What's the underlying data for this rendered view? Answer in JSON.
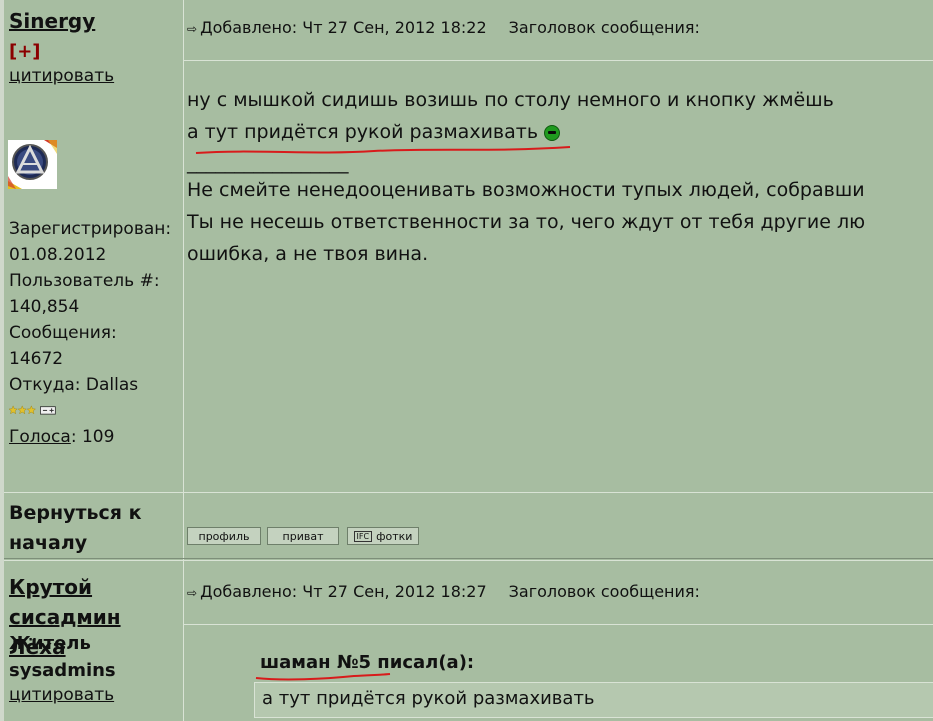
{
  "post1": {
    "author": "Sinergy",
    "plus": "[+]",
    "quote_label": "цитировать",
    "registered_label": "Зарегистрирован:",
    "registered_date": "01.08.2012",
    "user_num_label": "Пользователь #:",
    "user_num": "140,854",
    "messages_label": "Сообщения:",
    "messages": "14672",
    "from_label": "Откуда:",
    "from_value": "Dallas",
    "votes_label": "Голоса",
    "votes_value": ": 109",
    "meta_added": "Добавлено: Чт 27 Сен, 2012 18:22",
    "meta_title": "Заголовок сообщения:",
    "body_line1": "ну с мышкой сидишь возишь по столу немного и кнопку жмёшь",
    "body_line2": "а тут придётся рукой размахивать",
    "signature_rule": "_________________",
    "sig_line1": "Не смейте ненедооценивать возможности тупых людей, собравши",
    "sig_line2": "Ты не несешь ответственности за то, чего ждут от тебя другие лю",
    "sig_line3": "ошибка, а не твоя вина.",
    "back_to_top": "Вернуться к началу",
    "btn_profile": "профиль",
    "btn_private": "приват",
    "btn_photos": "фотки",
    "btn_photos_icon": "IFC"
  },
  "post2": {
    "author_line1": "Крутой",
    "author_line2": "сисадмин Лёха",
    "rank_line1": "Житель",
    "rank_line2": "sysadmins",
    "quote_label": "цитировать",
    "meta_added": "Добавлено: Чт 27 Сен, 2012 18:27",
    "meta_title": "Заголовок сообщения:",
    "quote_author": "шаман №5 писал(а):",
    "quote_text": "а тут придётся рукой размахивать"
  },
  "colors": {
    "background": "#a7bda1",
    "underline_red": "#d81b1b"
  }
}
